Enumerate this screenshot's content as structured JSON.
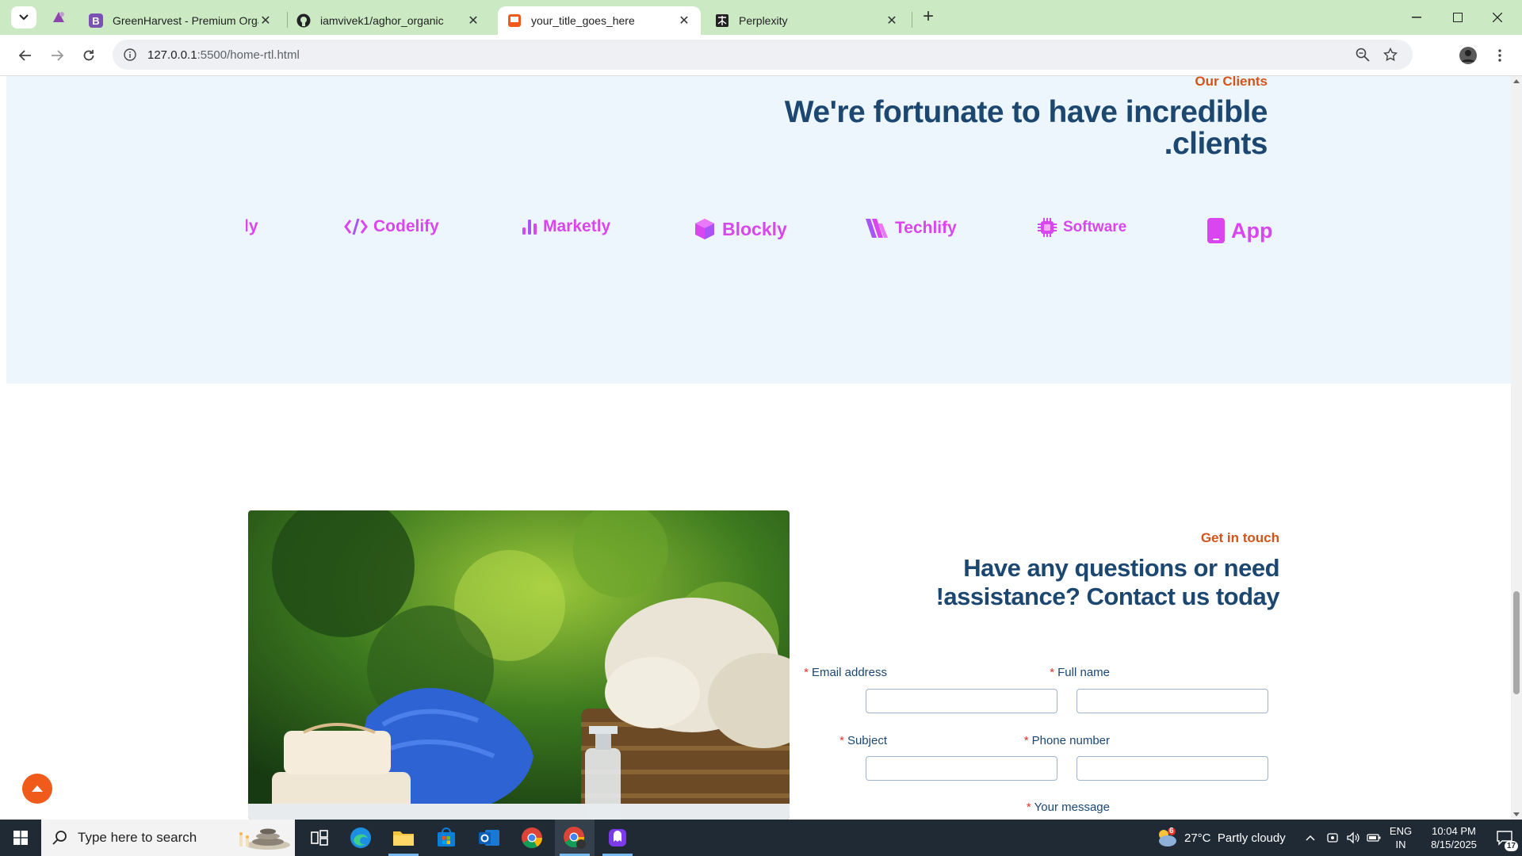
{
  "browser": {
    "tabs": [
      {
        "title": "GreenHarvest - Premium Organ",
        "active": false
      },
      {
        "title": "iamvivek1/aghor_organic",
        "active": false
      },
      {
        "title": "your_title_goes_here",
        "active": true
      },
      {
        "title": "Perplexity",
        "active": false
      }
    ],
    "url_host": "127.0.0.1",
    "url_rest": ":5500/home-rtl.html"
  },
  "clients_section": {
    "eyebrow": "Our Clients",
    "heading_line1": "We're fortunate to have incredible",
    "heading_line2": ".clients",
    "logos": [
      {
        "name": "ly",
        "icon": "cut-off-logo"
      },
      {
        "name": "Codelify",
        "icon": "code-icon"
      },
      {
        "name": "Marketly",
        "icon": "bar-chart-icon"
      },
      {
        "name": "Blockly",
        "icon": "cube-icon"
      },
      {
        "name": "Techlify",
        "icon": "stripes-icon"
      },
      {
        "name": "Software",
        "icon": "chip-icon"
      },
      {
        "name": "App",
        "icon": "phone-icon"
      }
    ],
    "logo_color": "#d946ef"
  },
  "contact_section": {
    "eyebrow": "Get in touch",
    "heading_line1": "Have any questions or need",
    "heading_line2": "!assistance? Contact us today",
    "fields": {
      "email": {
        "label": "Email address",
        "value": ""
      },
      "full_name": {
        "label": "Full name",
        "value": ""
      },
      "subject": {
        "label": "Subject",
        "value": ""
      },
      "phone": {
        "label": "Phone number",
        "value": ""
      },
      "message": {
        "label": "Your message"
      }
    },
    "required_marker": "*"
  },
  "colors": {
    "heading": "#1c4770",
    "accent": "#d2541a",
    "section_bg": "#eef6fd",
    "scroll_button": "#f05a1a"
  },
  "taskbar": {
    "search_placeholder": "Type here to search",
    "weather": "27°C  Partly cloudy",
    "weather_badge": "6",
    "language_line1": "ENG",
    "language_line2": "IN",
    "time": "10:04 PM",
    "date": "8/15/2025",
    "notifications": "17"
  }
}
